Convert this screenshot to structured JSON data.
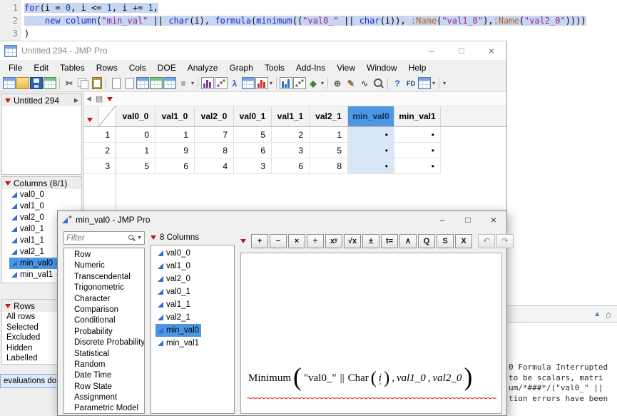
{
  "colors": {
    "accent_blue": "#4b97e4",
    "selected_cell_fill": "#d7e7f8",
    "red_triangle": "#bf1616",
    "keyword": "#1b2bc4",
    "string": "#9c219c",
    "name_label": "#b5651d",
    "number": "#0b4fa0",
    "squiggle": "#e01010",
    "selection_highlight": "#c9d6ef"
  },
  "code_editor": {
    "lines": [
      {
        "num": "1",
        "selected": true,
        "tokens": [
          {
            "t": "kw",
            "s": "for"
          },
          {
            "t": "pl",
            "s": "(i = "
          },
          {
            "t": "num",
            "s": "0"
          },
          {
            "t": "pl",
            "s": ", i <= "
          },
          {
            "t": "num",
            "s": "1"
          },
          {
            "t": "pl",
            "s": ", i += "
          },
          {
            "t": "num",
            "s": "1"
          },
          {
            "t": "pl",
            "s": ","
          }
        ]
      },
      {
        "num": "2",
        "selected": true,
        "tokens": [
          {
            "t": "pl",
            "s": "    "
          },
          {
            "t": "kw",
            "s": "new column"
          },
          {
            "t": "pl",
            "s": "("
          },
          {
            "t": "str",
            "s": "\"min_val\""
          },
          {
            "t": "pl",
            "s": " || "
          },
          {
            "t": "kw",
            "s": "char"
          },
          {
            "t": "pl",
            "s": "(i), "
          },
          {
            "t": "kw",
            "s": "formula"
          },
          {
            "t": "pl",
            "s": "("
          },
          {
            "t": "kw",
            "s": "minimum"
          },
          {
            "t": "pl",
            "s": "(("
          },
          {
            "t": "str",
            "s": "\"val0_\""
          },
          {
            "t": "pl",
            "s": " || "
          },
          {
            "t": "kw",
            "s": "char"
          },
          {
            "t": "pl",
            "s": "(i)), "
          },
          {
            "t": "nm",
            "s": ":Name"
          },
          {
            "t": "pl",
            "s": "("
          },
          {
            "t": "str",
            "s": "\"val1_0\""
          },
          {
            "t": "pl",
            "s": "),"
          },
          {
            "t": "nm",
            "s": ":Name"
          },
          {
            "t": "pl",
            "s": "("
          },
          {
            "t": "str",
            "s": "\"val2_0\""
          },
          {
            "t": "pl",
            "s": "))))"
          }
        ]
      },
      {
        "num": "3",
        "selected": false,
        "tokens": [
          {
            "t": "pl",
            "s": ")"
          }
        ]
      }
    ]
  },
  "main_window": {
    "title": "Untitled 294 - JMP Pro",
    "window_controls": {
      "minimize": "–",
      "maximize": "□",
      "close": "×"
    },
    "menus": [
      "File",
      "Edit",
      "Tables",
      "Rows",
      "Cols",
      "DOE",
      "Analyze",
      "Graph",
      "Tools",
      "Add-Ins",
      "View",
      "Window",
      "Help"
    ],
    "toolbar": [
      {
        "name": "new-data-table",
        "kind": "table"
      },
      {
        "name": "open",
        "kind": "folder"
      },
      {
        "name": "save",
        "kind": "disk"
      },
      {
        "name": "excel-import",
        "kind": "tableg"
      },
      {
        "sep": true
      },
      {
        "name": "cut",
        "kind": "glyph",
        "glyph": "✂",
        "fg": "#555555"
      },
      {
        "name": "copy",
        "kind": "pages"
      },
      {
        "name": "paste",
        "kind": "clip"
      },
      {
        "sep": true
      },
      {
        "name": "new-script",
        "kind": "page"
      },
      {
        "name": "journal",
        "kind": "page"
      },
      {
        "name": "data-table-window",
        "kind": "table"
      },
      {
        "name": "summary",
        "kind": "tableg"
      },
      {
        "name": "column-info",
        "kind": "table"
      },
      {
        "name": "row-selection",
        "kind": "glyph",
        "glyph": "≡",
        "fg": "#555555"
      },
      {
        "dd": true
      },
      {
        "sep": true
      },
      {
        "name": "distribution",
        "kind": "chartp"
      },
      {
        "name": "fit-y-by-x",
        "kind": "scatter"
      },
      {
        "name": "fit-model",
        "kind": "glyph",
        "glyph": "λ",
        "fg": "#1f5fbf"
      },
      {
        "name": "tabulate",
        "kind": "table"
      },
      {
        "name": "chart",
        "kind": "chartr"
      },
      {
        "dd": true
      },
      {
        "sep": true
      },
      {
        "name": "graph-builder",
        "kind": "chartb"
      },
      {
        "name": "scatterplot-3d",
        "kind": "scatter"
      },
      {
        "name": "maps",
        "kind": "glyph",
        "glyph": "◈",
        "fg": "#2e7d32"
      },
      {
        "dd": true
      },
      {
        "sep": true
      },
      {
        "name": "grabber-tool",
        "kind": "glyph",
        "glyph": "⊕",
        "fg": "#555555"
      },
      {
        "name": "brush-tool",
        "kind": "glyph",
        "glyph": "✎",
        "fg": "#8a5a2a"
      },
      {
        "name": "lasso-tool",
        "kind": "glyph",
        "glyph": "∿",
        "fg": "#555555"
      },
      {
        "name": "zoom-tool",
        "kind": "mag"
      },
      {
        "sep": true
      },
      {
        "name": "help",
        "kind": "glyph",
        "glyph": "?",
        "fg": "#1f5fbf"
      },
      {
        "name": "fd",
        "kind": "glyph",
        "glyph": "FD",
        "fg": "#1a3e6e"
      },
      {
        "name": "window-list",
        "kind": "table"
      },
      {
        "dd": true
      },
      {
        "sep": true
      },
      {
        "dd": true
      }
    ],
    "sidebar": {
      "table_panel_title": "Untitled 294",
      "columns_panel_title": "Columns (8/1)",
      "columns": [
        {
          "label": "val0_0",
          "formula": false,
          "selected": false
        },
        {
          "label": "val1_0",
          "formula": false,
          "selected": false
        },
        {
          "label": "val2_0",
          "formula": false,
          "selected": false
        },
        {
          "label": "val0_1",
          "formula": false,
          "selected": false
        },
        {
          "label": "val1_1",
          "formula": false,
          "selected": false
        },
        {
          "label": "val2_1",
          "formula": false,
          "selected": false
        },
        {
          "label": "min_val0",
          "formula": true,
          "selected": true
        },
        {
          "label": "min_val1",
          "formula": true,
          "selected": false
        }
      ],
      "rows_panel_title": "Rows",
      "rows_items": [
        "All rows",
        "Selected",
        "Excluded",
        "Hidden",
        "Labelled"
      ]
    },
    "grid": {
      "columns": [
        {
          "label": "val0_0",
          "selected": false
        },
        {
          "label": "val1_0",
          "selected": false
        },
        {
          "label": "val2_0",
          "selected": false
        },
        {
          "label": "val0_1",
          "selected": false
        },
        {
          "label": "val1_1",
          "selected": false
        },
        {
          "label": "val2_1",
          "selected": false
        },
        {
          "label": "min_val0",
          "selected": true
        },
        {
          "label": "min_val1",
          "selected": false
        }
      ],
      "rows": [
        {
          "n": "1",
          "values": [
            "0",
            "1",
            "7",
            "5",
            "2",
            "1",
            "•",
            "•"
          ]
        },
        {
          "n": "2",
          "values": [
            "1",
            "9",
            "8",
            "6",
            "3",
            "5",
            "•",
            "•"
          ]
        },
        {
          "n": "3",
          "values": [
            "5",
            "6",
            "4",
            "3",
            "6",
            "8",
            "•",
            "•"
          ]
        }
      ]
    }
  },
  "formula_dialog": {
    "title": "min_val0 - JMP Pro",
    "window_controls": {
      "minimize": "–",
      "maximize": "□",
      "close": "×"
    },
    "filter_placeholder": "Filter",
    "categories": [
      "Row",
      "Numeric",
      "Transcendental",
      "Trigonometric",
      "Character",
      "Comparison",
      "Conditional",
      "Probability",
      "Discrete Probability",
      "Statistical",
      "Random",
      "Date Time",
      "Row State",
      "Assignment",
      "Parametric Model"
    ],
    "columns_header": "8 Columns",
    "columns": [
      {
        "label": "val0_0",
        "selected": false
      },
      {
        "label": "val1_0",
        "selected": false
      },
      {
        "label": "val2_0",
        "selected": false
      },
      {
        "label": "val0_1",
        "selected": false
      },
      {
        "label": "val1_1",
        "selected": false
      },
      {
        "label": "val2_1",
        "selected": false
      },
      {
        "label": "min_val0",
        "selected": true
      },
      {
        "label": "min_val1",
        "selected": false
      }
    ],
    "toolbar_buttons": [
      {
        "name": "add-button",
        "glyph": "+"
      },
      {
        "name": "subtract-button",
        "glyph": "−"
      },
      {
        "name": "multiply-button",
        "glyph": "×"
      },
      {
        "name": "divide-button",
        "glyph": "÷"
      },
      {
        "name": "power-button",
        "glyph": "xʸ"
      },
      {
        "name": "root-button",
        "glyph": "√x"
      },
      {
        "name": "sign-button",
        "glyph": "±"
      },
      {
        "name": "local-variable-button",
        "glyph": "t="
      },
      {
        "name": "peel-expression-button",
        "glyph": "∧"
      },
      {
        "name": "quantile-button",
        "glyph": "Q"
      },
      {
        "name": "switch-terms-button",
        "glyph": "S"
      },
      {
        "name": "delete-button",
        "glyph": "X"
      },
      {
        "name": "undo-button",
        "glyph": "↶",
        "disabled": true,
        "gap": true
      },
      {
        "name": "redo-button",
        "glyph": "↷",
        "disabled": true
      }
    ],
    "formula_tokens": [
      {
        "k": "fn",
        "s": "Minimum"
      },
      {
        "k": "bigparen",
        "s": "("
      },
      {
        "k": "str",
        "s": "\"val0_\""
      },
      {
        "k": "op",
        "s": "||"
      },
      {
        "k": "fn",
        "s": "Char"
      },
      {
        "k": "midparen",
        "s": "("
      },
      {
        "k": "var",
        "s": "i"
      },
      {
        "k": "caret",
        "s": "^"
      },
      {
        "k": "midparen",
        "s": ")"
      },
      {
        "k": "comma",
        "s": ","
      },
      {
        "k": "col",
        "s": "val1_0"
      },
      {
        "k": "comma",
        "s": ","
      },
      {
        "k": "col",
        "s": "val2_0"
      },
      {
        "k": "bigparen",
        "s": ")"
      }
    ]
  },
  "log_panel": {
    "lines": [
      "0 Formula Interrupted",
      "to be scalars, matri",
      "um/*###*/(\"val0_\" ||",
      "tion errors have been"
    ]
  },
  "status_tooltip": {
    "text": "evaluations do"
  }
}
